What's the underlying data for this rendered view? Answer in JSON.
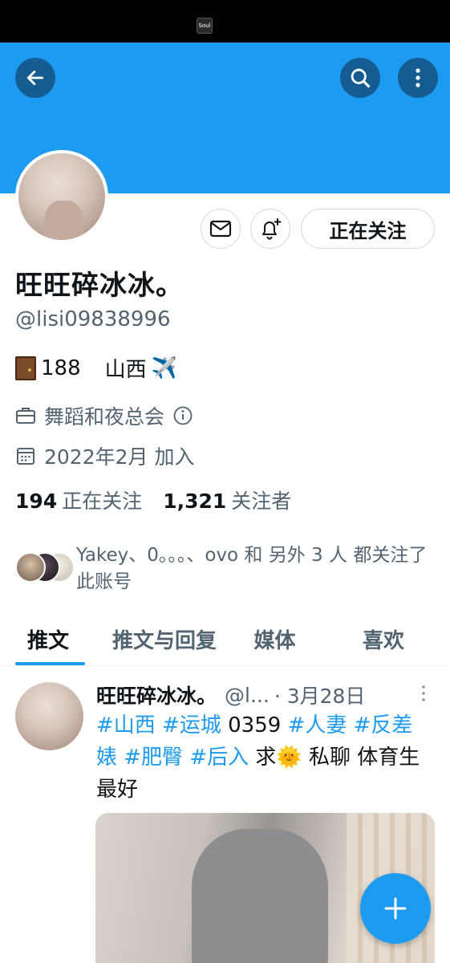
{
  "status_bar": {
    "app_icon_label": "Soul"
  },
  "header": {
    "back_icon": "arrow-left-icon",
    "search_icon": "search-icon",
    "more_icon": "more-vertical-icon"
  },
  "profile": {
    "display_name": "旺旺碎冰冰。",
    "handle": "@lisi09838996",
    "bio_number": "188",
    "bio_location": "山西",
    "bio_plane": "✈️",
    "category": "舞蹈和夜总会",
    "joined": "2022年2月 加入",
    "following_count": "194",
    "following_label": "正在关注",
    "followers_count": "1,321",
    "followers_label": "关注者",
    "followed_by_text": "Yakey、0。。。、ovo 和 另外 3 人 都关注了此账号"
  },
  "actions": {
    "following_button": "正在关注",
    "message_icon": "mail-icon",
    "notify_icon": "bell-plus-icon"
  },
  "tabs": [
    {
      "label": "推文",
      "active": true
    },
    {
      "label": "推文与回复",
      "active": false
    },
    {
      "label": "媒体",
      "active": false
    },
    {
      "label": "喜欢",
      "active": false
    }
  ],
  "tweet": {
    "name": "旺旺碎冰冰。",
    "handle": "@l...",
    "date": "· 3月28日",
    "tag1": "#山西",
    "tag2": "#运城",
    "plain1": " 0359 ",
    "tag3": "#人妻",
    "tag4": "#反差婊",
    "tag5": "#肥臀",
    "tag6": "#后入",
    "plain2": " 求",
    "sun": "🌞",
    "plain3": " 私聊 体育生最好"
  },
  "fab_icon": "plus-icon",
  "colors": {
    "accent": "#1d9bf0",
    "text": "#0f1419",
    "muted": "#536471"
  }
}
